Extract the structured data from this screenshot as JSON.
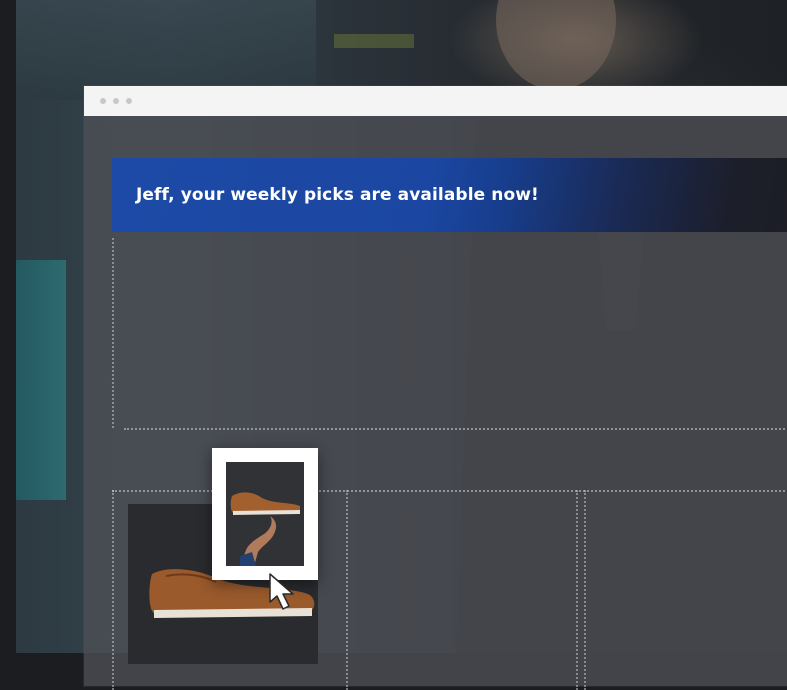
{
  "banner": {
    "message": "Jeff, your weekly picks are available now!",
    "color_start": "#1d4aa6",
    "color_end": "#1d1e24"
  },
  "window": {
    "titlebar_dots": 3,
    "titlebar_color": "#f4f4f5"
  },
  "product": {
    "image_icon": "shoe-icon",
    "thumbnail_icon": "shoe-icon"
  },
  "pointer": {
    "icon": "cursor-arrow-icon"
  }
}
